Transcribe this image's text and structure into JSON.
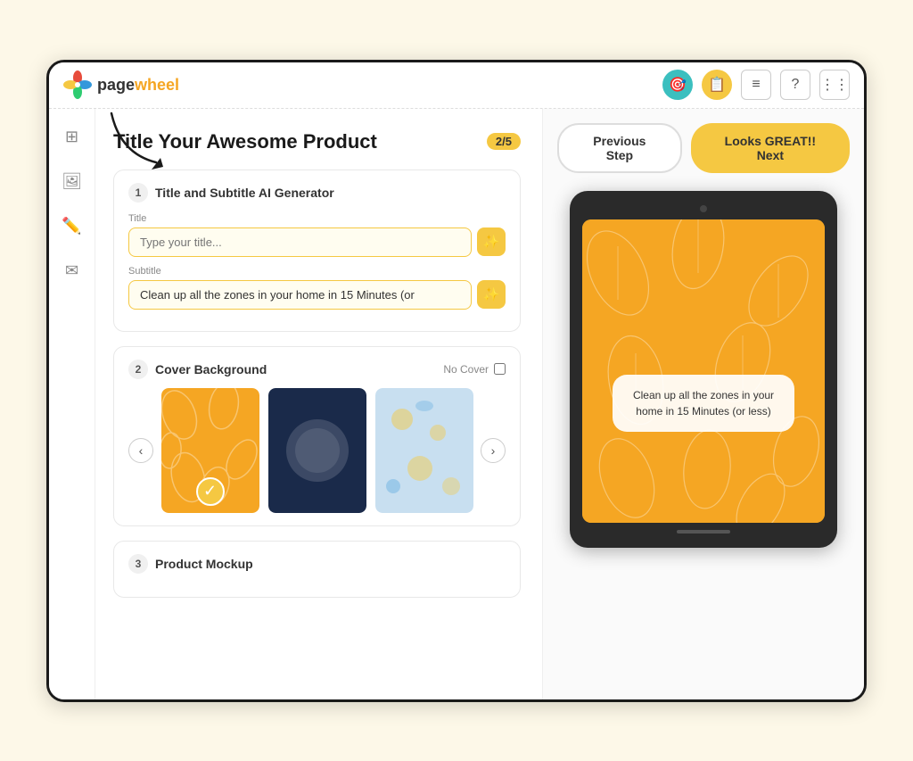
{
  "app": {
    "name": "page",
    "name_highlight": "wheel",
    "logo_alt": "pagewheel logo"
  },
  "nav": {
    "icon1": "🎯",
    "icon2": "📋",
    "icon3": "≡",
    "icon4": "?",
    "icon5": "⋮⋮"
  },
  "sidebar": {
    "icon1": "⊞",
    "icon2": "🖼",
    "icon3": "✏️",
    "icon4": "✉"
  },
  "left_panel": {
    "title": "Title Your Awesome Product",
    "step": "2/5",
    "section1": {
      "number": "1",
      "title": "Title and Subtitle AI Generator",
      "title_label": "Title",
      "title_placeholder": "Type your title...",
      "subtitle_label": "Subtitle",
      "subtitle_value": "Clean up all the zones in your home in 15 Minutes (or"
    },
    "section2": {
      "number": "2",
      "title": "Cover Background",
      "no_cover_label": "No Cover"
    },
    "section3": {
      "number": "3",
      "title": "Product Mockup"
    }
  },
  "right_panel": {
    "prev_button": "Previous Step",
    "next_button": "Looks GREAT!! Next",
    "tablet_subtitle": "Clean up all the zones in your home in 15 Minutes (or less)"
  }
}
